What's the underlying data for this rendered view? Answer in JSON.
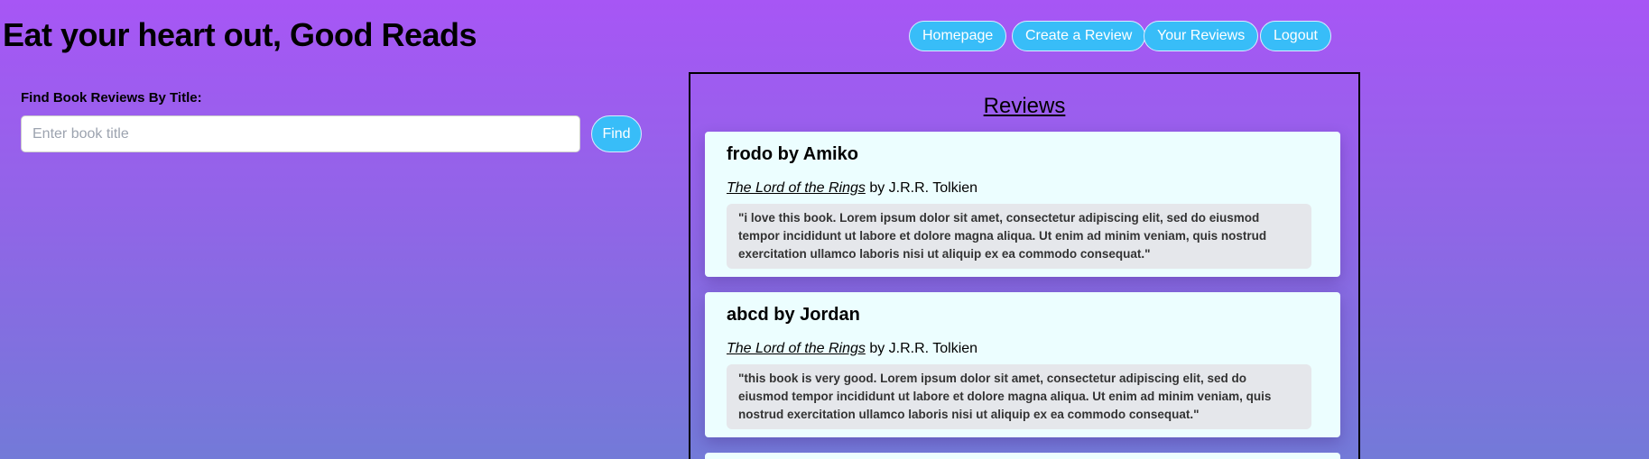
{
  "header": {
    "title": "Eat your heart out, Good Reads"
  },
  "nav": [
    "Homepage",
    "Create a Review",
    "Your Reviews",
    "Logout"
  ],
  "search": {
    "label": "Find Book Reviews By Title:",
    "placeholder": "Enter book title",
    "value": "",
    "button": "Find"
  },
  "reviews": {
    "title": "Reviews",
    "items": [
      {
        "heading": "frodo by Amiko",
        "book_title": "The Lord of the Rings",
        "book_author": "by J.R.R. Tolkien",
        "text": "\"i love this book. Lorem ipsum dolor sit amet, consectetur adipiscing elit, sed do eiusmod tempor incididunt ut labore et dolore magna aliqua. Ut enim ad minim veniam, quis nostrud exercitation ullamco laboris nisi ut aliquip ex ea commodo consequat.\""
      },
      {
        "heading": "abcd by Jordan",
        "book_title": "The Lord of the Rings",
        "book_author": "by J.R.R. Tolkien",
        "text": "\"this book is very good. Lorem ipsum dolor sit amet, consectetur adipiscing elit, sed do eiusmod tempor incididunt ut labore et dolore magna aliqua. Ut enim ad minim veniam, quis nostrud exercitation ullamco laboris nisi ut aliquip ex ea commodo consequat.\""
      }
    ]
  }
}
